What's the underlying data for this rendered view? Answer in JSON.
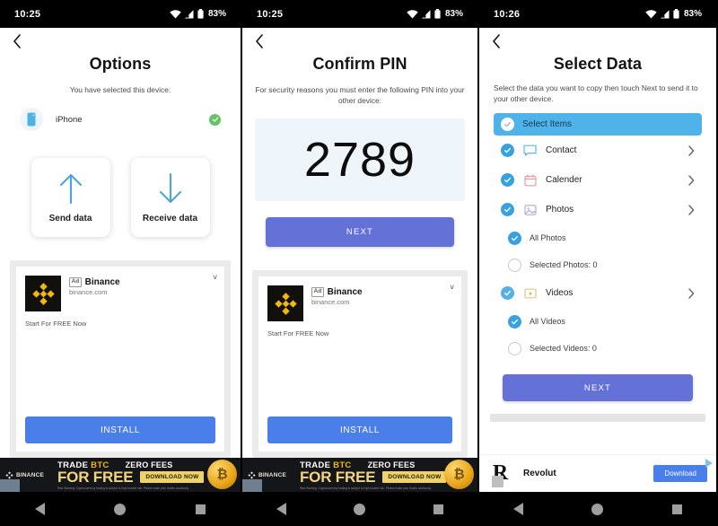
{
  "theme": {
    "accent_blue": "#6472d8",
    "light_blue": "#4fb3ea",
    "check_blue": "#3aa1e0",
    "green": "#62c462",
    "ad_blue": "#4a7ee8",
    "binance_gold": "#f0b90b",
    "status_bg": "#000000"
  },
  "panels": [
    {
      "status": {
        "time": "10:25",
        "battery": "83%",
        "wifi_icon": "wifi-icon",
        "signal_icon": "signal-icon",
        "battery_icon": "battery-icon"
      },
      "back_icon": "back-chevron-icon",
      "title": "Options",
      "subtitle": "You have selected this device:",
      "device": {
        "name": "iPhone",
        "icon": "phone-icon",
        "status_icon": "check-circle-icon"
      },
      "cards": [
        {
          "label": "Send data",
          "icon": "arrow-up-icon"
        },
        {
          "label": "Receive data",
          "icon": "arrow-down-icon"
        }
      ],
      "ad": {
        "badge": "Ad",
        "brand": "Binance",
        "url": "binance.com",
        "body": "Start For FREE Now",
        "cta": "INSTALL",
        "tag_icon": "adchoices-icon",
        "logo_icon": "binance-logo-icon"
      },
      "banner": {
        "brand": "BINANCE",
        "line1_a": "TRADE ",
        "line1_b": "BTC",
        "line1_c": "ZERO FEES",
        "line2": "FOR FREE",
        "cta": "DOWNLOAD NOW",
        "fine_print": "Risk Warning: Cryptocurrency trading is subject to high market risk. Please make your trades cautiously."
      }
    },
    {
      "status": {
        "time": "10:25",
        "battery": "83%",
        "wifi_icon": "wifi-icon",
        "signal_icon": "signal-icon",
        "battery_icon": "battery-icon"
      },
      "back_icon": "back-chevron-icon",
      "title": "Confirm PIN",
      "subtitle": "For security reasons you must enter the following PIN into your other device:",
      "pin": "2789",
      "next_label": "NEXT",
      "ad": {
        "badge": "Ad",
        "brand": "Binance",
        "url": "binance.com",
        "body": "Start For FREE Now",
        "cta": "INSTALL",
        "tag_icon": "adchoices-icon",
        "logo_icon": "binance-logo-icon"
      },
      "banner": {
        "brand": "BINANCE",
        "line1_a": "TRADE ",
        "line1_b": "BTC",
        "line1_c": "ZERO FEES",
        "line2": "FOR FREE",
        "cta": "DOWNLOAD NOW",
        "fine_print": "Risk Warning: Cryptocurrency trading is subject to high market risk. Please make your trades cautiously."
      }
    },
    {
      "status": {
        "time": "10:26",
        "battery": "83%",
        "wifi_icon": "wifi-icon",
        "signal_icon": "signal-icon",
        "battery_icon": "battery-icon"
      },
      "back_icon": "back-chevron-icon",
      "title": "Select Data",
      "subtitle": "Select the data you want to copy then touch Next to send it to your other device.",
      "select_header": {
        "label": "Select Items",
        "checked": true
      },
      "items": [
        {
          "label": "Contact",
          "icon": "message-icon",
          "checked": true,
          "chevron": true,
          "sub": false
        },
        {
          "label": "Calender",
          "icon": "calendar-icon",
          "checked": true,
          "chevron": true,
          "sub": false
        },
        {
          "label": "Photos",
          "icon": "image-icon",
          "checked": true,
          "chevron": true,
          "sub": false
        },
        {
          "label": "All Photos",
          "icon": "",
          "checked": true,
          "chevron": false,
          "sub": true
        },
        {
          "label": "Selected Photos: 0",
          "icon": "",
          "checked": false,
          "chevron": false,
          "sub": true
        },
        {
          "label": "Videos",
          "icon": "video-icon",
          "checked": true,
          "chevron": true,
          "sub": false
        },
        {
          "label": "All Videos",
          "icon": "",
          "checked": true,
          "chevron": false,
          "sub": true
        },
        {
          "label": "Selected Videos: 0",
          "icon": "",
          "checked": false,
          "chevron": false,
          "sub": true
        }
      ],
      "next_label": "NEXT",
      "revolut_ad": {
        "name": "Revolut",
        "cta": "Download",
        "logo_icon": "revolut-logo-icon",
        "tag_icon": "adchoices-icon"
      }
    }
  ],
  "navbar": {
    "back_icon": "nav-back-icon",
    "home_icon": "nav-home-icon",
    "recents_icon": "nav-recents-icon"
  }
}
